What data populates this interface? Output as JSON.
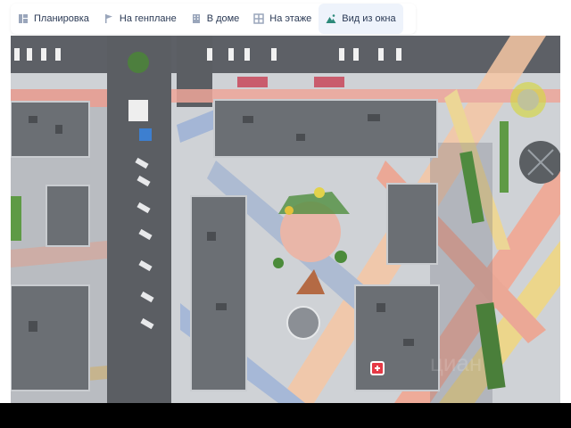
{
  "tabs": [
    {
      "label": "Планировка",
      "icon": "layout-icon",
      "active": false
    },
    {
      "label": "На генплане",
      "icon": "flag-icon",
      "active": false
    },
    {
      "label": "В доме",
      "icon": "building-icon",
      "active": false
    },
    {
      "label": "На этаже",
      "icon": "floor-icon",
      "active": false
    },
    {
      "label": "Вид из окна",
      "icon": "mountain-icon",
      "active": true
    }
  ],
  "colors": {
    "accent": "#2d6fd6",
    "marker": "#e53945",
    "tab_text": "#2b3a55",
    "active_tab_bg": "#eef3fb"
  },
  "map": {
    "description_icon": "site-plan-aerial",
    "marker_icon": "apartment-marker-icon"
  }
}
